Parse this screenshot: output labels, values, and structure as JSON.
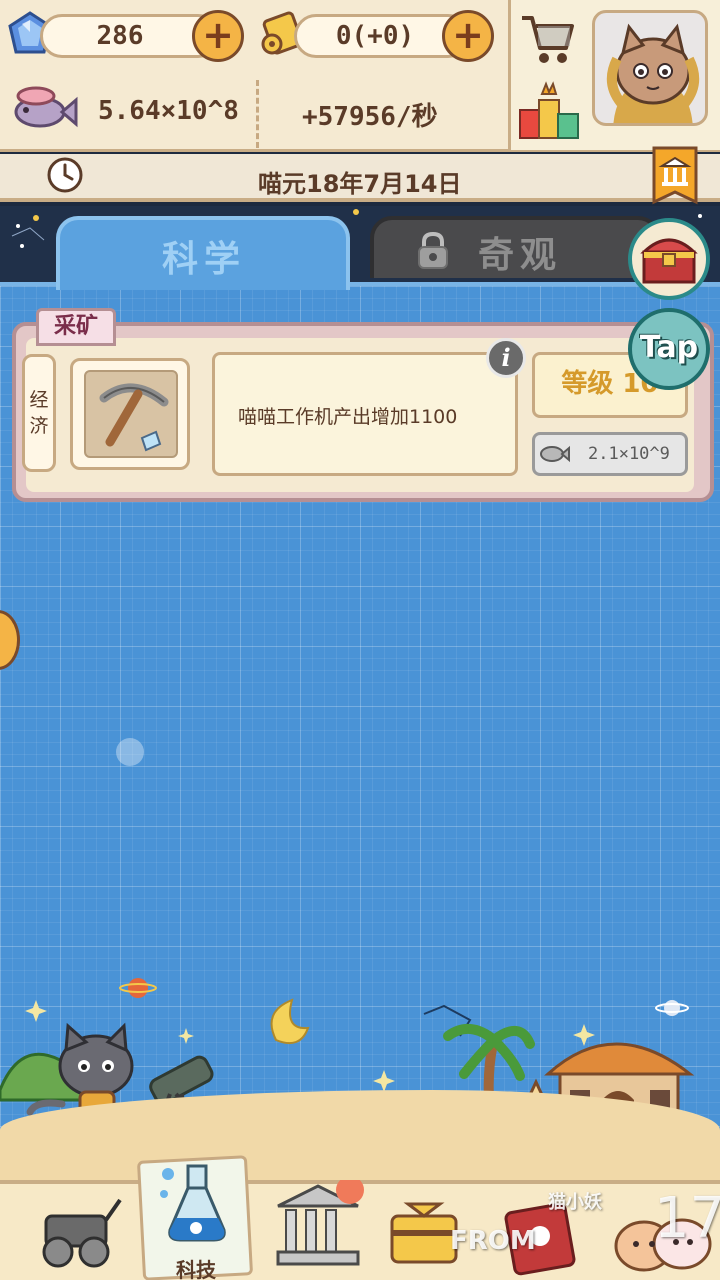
{
  "header": {
    "gems": "286",
    "scrolls": "0(+0)",
    "fish_total": "5.64×10^8",
    "fish_rate": "+57956/秒"
  },
  "date": "喵元18年7月14日",
  "tabs": [
    {
      "label": "科学",
      "active": true
    },
    {
      "label": "奇观",
      "active": false,
      "locked": true
    }
  ],
  "card": {
    "category": "采矿",
    "side_label": "经济",
    "description": "喵喵工作机产出增加1100",
    "level": "等级 10",
    "cost": "2.1×10^9"
  },
  "floating": {
    "tap_label": "Tap"
  },
  "bottom_nav": {
    "active_label": "科技"
  },
  "watermark": {
    "line1": "猫小妖",
    "line2": "FROM",
    "number": "17"
  },
  "colors": {
    "grid_blue": "#4a93d6",
    "cream": "#f5ead2",
    "brown_text": "#5a3b28",
    "gold": "#f4b446",
    "teal": "#2b8a89"
  }
}
